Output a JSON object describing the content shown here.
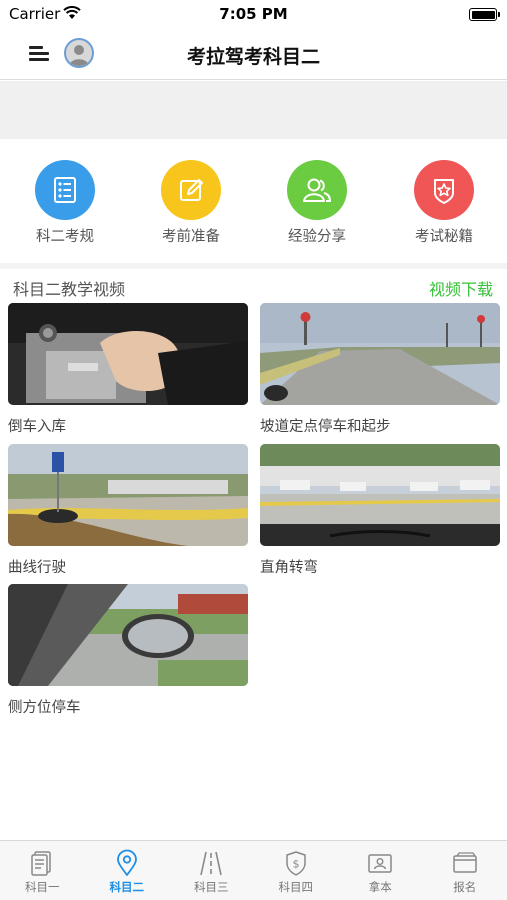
{
  "status_bar": {
    "carrier": "Carrier",
    "time": "7:05 PM"
  },
  "nav": {
    "title": "考拉驾考科目二"
  },
  "categories": [
    {
      "label": "科二考规",
      "icon": "list-icon",
      "color": "#3a9de9"
    },
    {
      "label": "考前准备",
      "icon": "edit-icon",
      "color": "#f7c51b"
    },
    {
      "label": "经验分享",
      "icon": "users-icon",
      "color": "#6bcb41"
    },
    {
      "label": "考试秘籍",
      "icon": "star-badge-icon",
      "color": "#f05656"
    }
  ],
  "section": {
    "title": "科目二教学视频",
    "download_label": "视频下载",
    "download_color": "#38c23a"
  },
  "videos": [
    {
      "title": "倒车入库"
    },
    {
      "title": "坡道定点停车和起步"
    },
    {
      "title": "曲线行驶"
    },
    {
      "title": "直角转弯"
    },
    {
      "title": "侧方位停车"
    }
  ],
  "tabs": [
    {
      "label": "科目一",
      "icon": "document-icon"
    },
    {
      "label": "科目二",
      "icon": "location-pin-icon",
      "active": true
    },
    {
      "label": "科目三",
      "icon": "road-icon"
    },
    {
      "label": "科目四",
      "icon": "shield-dollar-icon"
    },
    {
      "label": "拿本",
      "icon": "id-card-icon"
    },
    {
      "label": "报名",
      "icon": "wallet-icon"
    }
  ],
  "colors": {
    "accent": "#1e8ee6",
    "tab_inactive": "#777777"
  }
}
